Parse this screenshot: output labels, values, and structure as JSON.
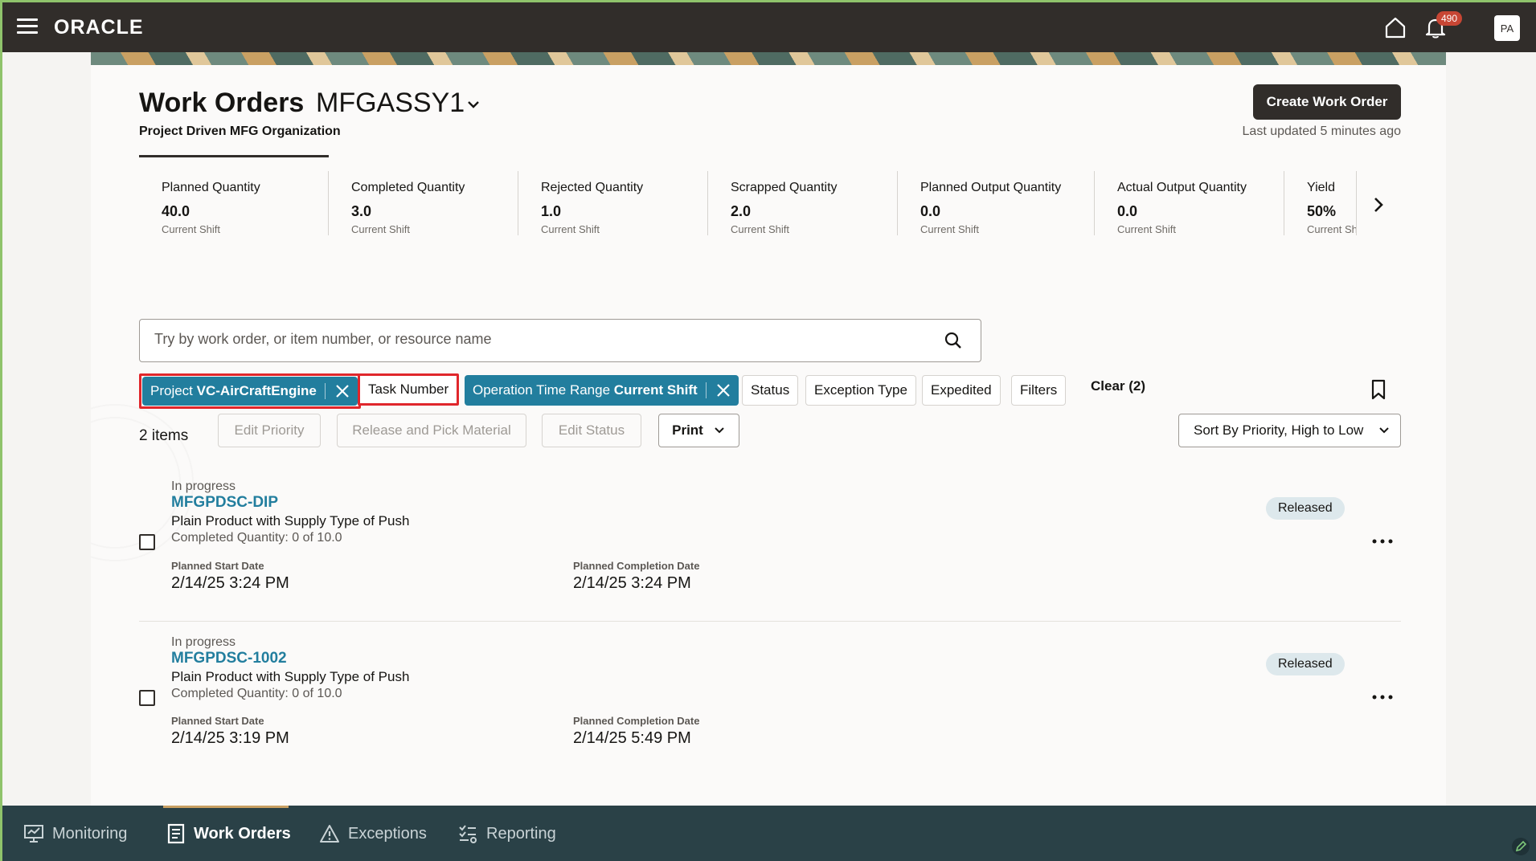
{
  "header": {
    "logo": "ORACLE",
    "notification_count": "490",
    "avatar_initials": "PA"
  },
  "page": {
    "title": "Work Orders",
    "org_code": "MFGASSY1",
    "org_name": "Project Driven MFG Organization",
    "create_button": "Create Work Order",
    "last_updated": "Last updated 5 minutes ago"
  },
  "metrics": [
    {
      "label": "Planned Quantity",
      "value": "40.0",
      "sub": "Current Shift"
    },
    {
      "label": "Completed Quantity",
      "value": "3.0",
      "sub": "Current Shift"
    },
    {
      "label": "Rejected Quantity",
      "value": "1.0",
      "sub": "Current Shift"
    },
    {
      "label": "Scrapped Quantity",
      "value": "2.0",
      "sub": "Current Shift"
    },
    {
      "label": "Planned Output Quantity",
      "value": "0.0",
      "sub": "Current Shift"
    },
    {
      "label": "Actual Output Quantity",
      "value": "0.0",
      "sub": "Current Shift"
    },
    {
      "label": "Yield",
      "value": "50%",
      "sub": "Current Shift"
    }
  ],
  "search": {
    "placeholder": "Try by work order, or item number, or resource name"
  },
  "filters": {
    "project_chip_prefix": "Project",
    "project_chip_value": "VC-AirCraftEngine",
    "task_number": "Task Number",
    "optr_prefix": "Operation Time Range",
    "optr_value": "Current Shift",
    "status": "Status",
    "exception_type": "Exception Type",
    "expedited": "Expedited",
    "filters": "Filters",
    "clear": "Clear (2)"
  },
  "toolbar": {
    "items_count": "2 items",
    "edit_priority": "Edit Priority",
    "release_pick": "Release and Pick Material",
    "edit_status": "Edit Status",
    "print": "Print",
    "sort": "Sort By Priority, High to Low"
  },
  "work_orders": [
    {
      "status": "In progress",
      "number": "MFGPDSC-DIP",
      "description": "Plain Product with Supply Type of Push",
      "completed": "Completed Quantity: 0 of 10.0",
      "start_label": "Planned Start Date",
      "start_value": "2/14/25 3:24 PM",
      "completion_label": "Planned Completion Date",
      "completion_value": "2/14/25 3:24 PM",
      "badge": "Released"
    },
    {
      "status": "In progress",
      "number": "MFGPDSC-1002",
      "description": "Plain Product with Supply Type of Push",
      "completed": "Completed Quantity: 0 of 10.0",
      "start_label": "Planned Start Date",
      "start_value": "2/14/25 3:19 PM",
      "completion_label": "Planned Completion Date",
      "completion_value": "2/14/25 5:49 PM",
      "badge": "Released"
    }
  ],
  "bottom_nav": {
    "monitoring": "Monitoring",
    "work_orders": "Work Orders",
    "exceptions": "Exceptions",
    "reporting": "Reporting"
  },
  "colors": {
    "accent": "#227e9e",
    "header_bg": "#312d2a",
    "bottom_bar_bg": "#2a4147",
    "highlight_border": "#e0262b"
  },
  "icons": [
    "hamburger-icon",
    "home-icon",
    "bell-icon",
    "chevron-down-icon",
    "chevron-right-icon",
    "search-icon",
    "close-icon",
    "bookmark-icon",
    "more-icon",
    "monitor-icon",
    "document-icon",
    "warning-icon",
    "report-icon",
    "edit-icon"
  ]
}
